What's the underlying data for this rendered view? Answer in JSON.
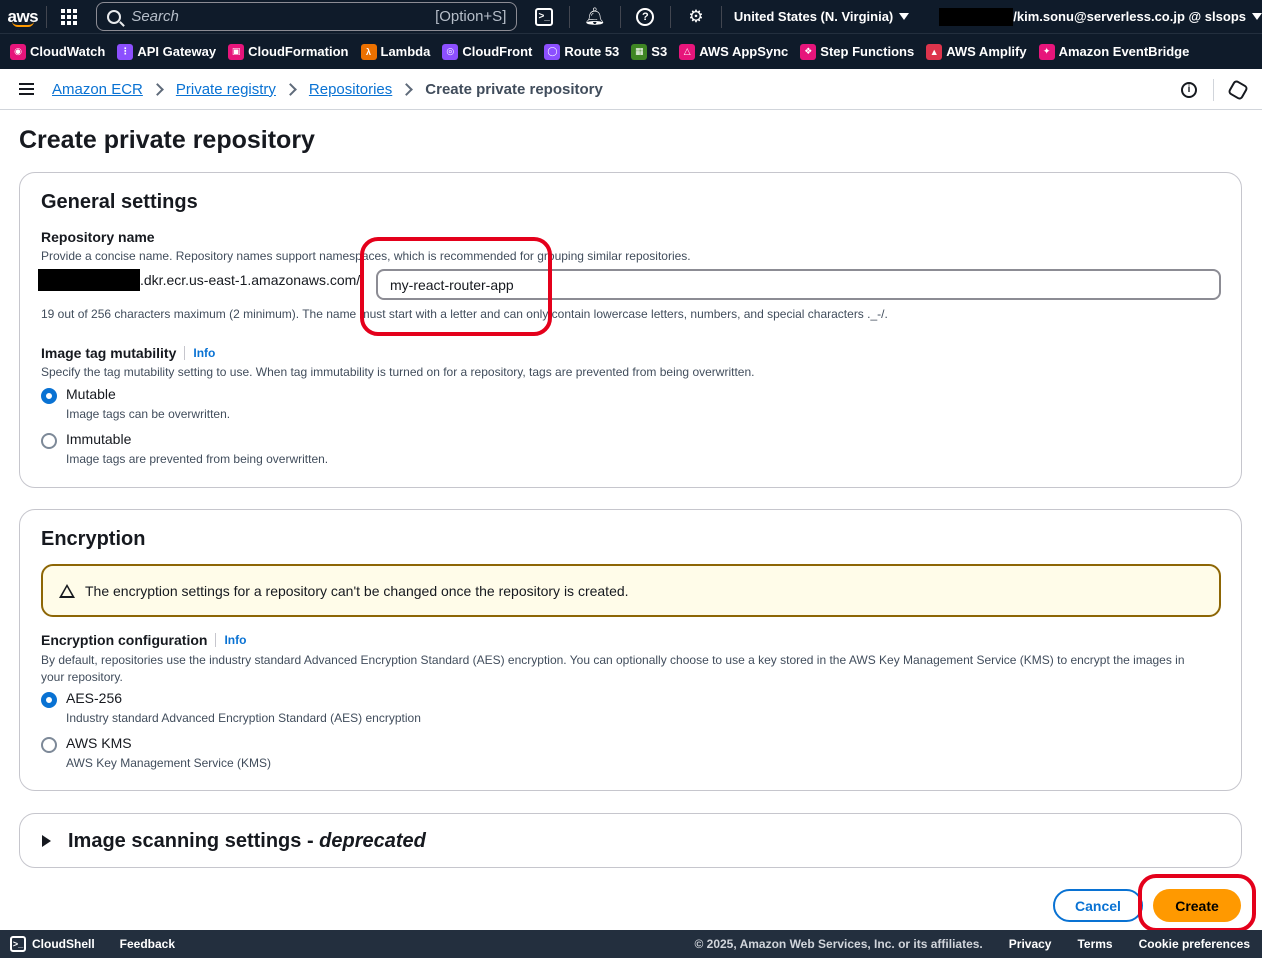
{
  "topnav": {
    "logo": "aws",
    "search_placeholder": "Search",
    "search_shortcut": "[Option+S]",
    "region": "United States (N. Virginia)",
    "account": "/kim.sonu@serverless.co.jp @ slsops",
    "icons": [
      "grid-icon",
      "cloudshell-icon",
      "bell-icon",
      "help-icon",
      "gear-icon"
    ]
  },
  "favorites": [
    {
      "label": "CloudWatch",
      "color": "#e7157b"
    },
    {
      "label": "API Gateway",
      "color": "#8c4fff"
    },
    {
      "label": "CloudFormation",
      "color": "#e7157b"
    },
    {
      "label": "Lambda",
      "color": "#ed7100"
    },
    {
      "label": "CloudFront",
      "color": "#8c4fff"
    },
    {
      "label": "Route 53",
      "color": "#8c4fff"
    },
    {
      "label": "S3",
      "color": "#3f8624"
    },
    {
      "label": "AWS AppSync",
      "color": "#e7157b"
    },
    {
      "label": "Step Functions",
      "color": "#e7157b"
    },
    {
      "label": "AWS Amplify",
      "color": "#dd344c"
    },
    {
      "label": "Amazon EventBridge",
      "color": "#e7157b"
    }
  ],
  "breadcrumb": {
    "items": [
      "Amazon ECR",
      "Private registry",
      "Repositories"
    ],
    "current": "Create private repository"
  },
  "page": {
    "title": "Create private repository"
  },
  "general": {
    "heading": "General settings",
    "repo_name_label": "Repository name",
    "repo_name_desc": "Provide a concise name. Repository names support namespaces, which is recommended for grouping similar repositories.",
    "uri_suffix": ".dkr.ecr.us-east-1.amazonaws.com/",
    "repo_name_value": "my-react-router-app",
    "repo_name_hint": "19 out of 256 characters maximum (2 minimum). The name must start with a letter and can only contain lowercase letters, numbers, and special characters ._-/.",
    "mutability_label": "Image tag mutability",
    "info": "Info",
    "mutability_desc": "Specify the tag mutability setting to use. When tag immutability is turned on for a repository, tags are prevented from being overwritten.",
    "options": [
      {
        "label": "Mutable",
        "desc": "Image tags can be overwritten.",
        "selected": true
      },
      {
        "label": "Immutable",
        "desc": "Image tags are prevented from being overwritten.",
        "selected": false
      }
    ]
  },
  "encryption": {
    "heading": "Encryption",
    "warning": "The encryption settings for a repository can't be changed once the repository is created.",
    "config_label": "Encryption configuration",
    "info": "Info",
    "config_desc": "By default, repositories use the industry standard Advanced Encryption Standard (AES) encryption. You can optionally choose to use a key stored in the AWS Key Management Service (KMS) to encrypt the images in your repository.",
    "options": [
      {
        "label": "AES-256",
        "desc": "Industry standard Advanced Encryption Standard (AES) encryption",
        "selected": true
      },
      {
        "label": "AWS KMS",
        "desc": "AWS Key Management Service (KMS)",
        "selected": false
      }
    ]
  },
  "scanning": {
    "heading": "Image scanning settings",
    "dash": " - ",
    "tag": "deprecated"
  },
  "actions": {
    "cancel": "Cancel",
    "create": "Create"
  },
  "footer": {
    "cloudshell": "CloudShell",
    "feedback": "Feedback",
    "copyright": "© 2025, Amazon Web Services, Inc. or its affiliates.",
    "links": [
      "Privacy",
      "Terms",
      "Cookie preferences"
    ]
  },
  "colors": {
    "nav_bg": "#0f1b2a",
    "link": "#0972d3",
    "primary_button": "#ff9900",
    "callout": "#e4001b",
    "warning_bg": "#fffce9"
  }
}
